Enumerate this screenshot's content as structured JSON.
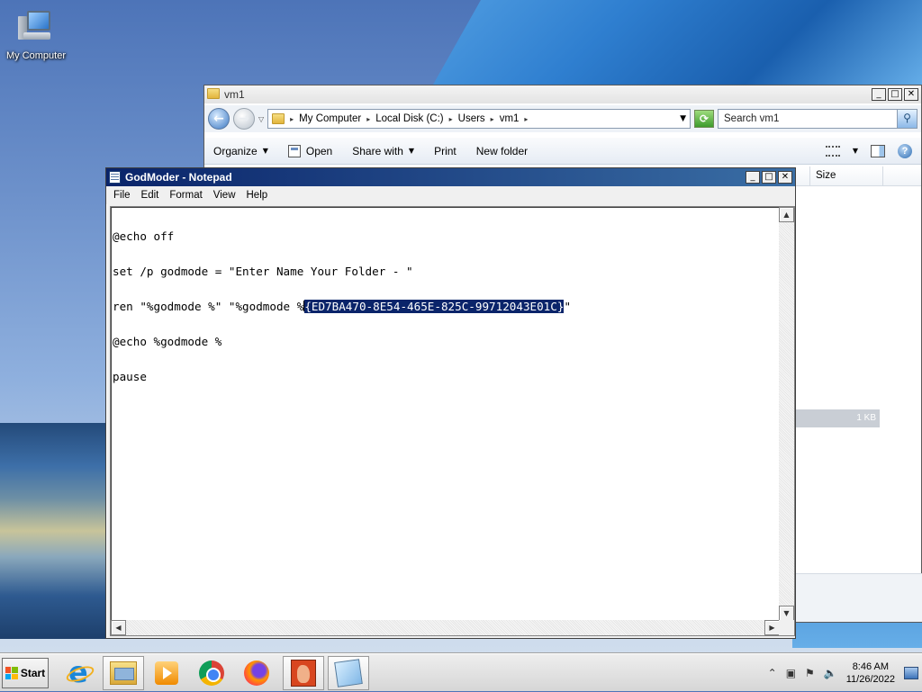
{
  "desktop": {
    "icons": [
      {
        "label": "My Computer",
        "icon": "computer-icon"
      }
    ]
  },
  "explorer": {
    "title": "vm1",
    "breadcrumbs": [
      "My Computer",
      "Local Disk (C:)",
      "Users",
      "vm1"
    ],
    "search_placeholder": "Search vm1",
    "commands": {
      "organize": "Organize",
      "open": "Open",
      "share_with": "Share with",
      "print": "Print",
      "new_folder": "New folder"
    },
    "columns": {
      "size": "Size"
    },
    "selected_file_size": "1 KB"
  },
  "notepad": {
    "title": "GodModer - Notepad",
    "menu": [
      "File",
      "Edit",
      "Format",
      "View",
      "Help"
    ],
    "lines": {
      "l1": "@echo off",
      "l2": "set /p godmode = \"Enter Name Your Folder - \"",
      "l3_before": "ren \"%godmode %\" \"%godmode %",
      "l3_selected": "{ED7BA470-8E54-465E-825C-99712043E01C}",
      "l3_after": "\"",
      "l4": "@echo %godmode %",
      "l5": "pause"
    }
  },
  "taskbar": {
    "start_label": "Start",
    "apps": [
      "internet-explorer-icon",
      "windows-explorer-icon",
      "media-player-icon",
      "chrome-icon",
      "firefox-icon",
      "cheat-app-icon",
      "notepad-icon"
    ],
    "clock": {
      "time": "8:46 AM",
      "date": "11/26/2022"
    }
  },
  "colors": {
    "selection": "#0a246a",
    "notepad_titlebar": "#0a246a",
    "desktop_blue": "#4d74b8"
  }
}
